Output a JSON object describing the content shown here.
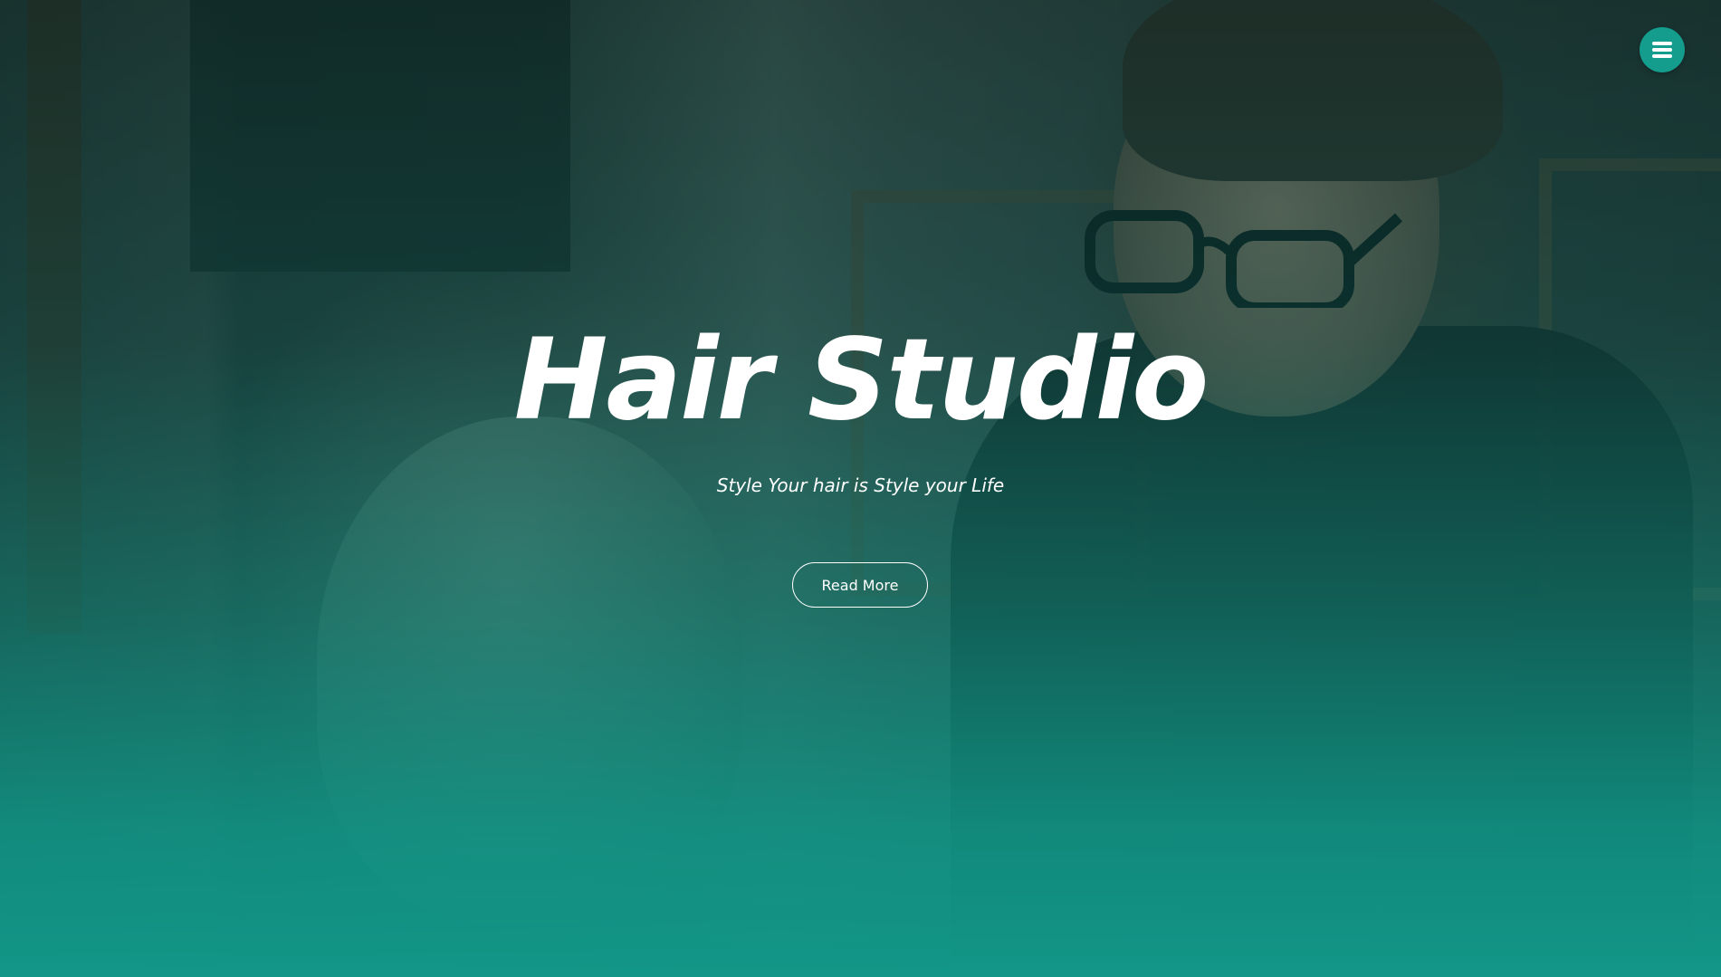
{
  "hero": {
    "title": "Hair Studio",
    "tagline": "Style Your hair is Style your Life",
    "cta_label": "Read More"
  },
  "nav": {
    "menu_icon": "hamburger-menu-icon"
  },
  "colors": {
    "accent": "#149c8c",
    "overlay_bottom": "#129687",
    "text": "#ffffff"
  }
}
